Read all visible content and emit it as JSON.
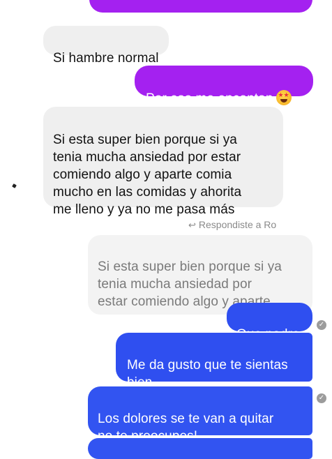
{
  "messages": [
    {
      "id": "m0",
      "direction": "outgoing",
      "color": "#a421f0",
      "text": ""
    },
    {
      "id": "m1",
      "direction": "incoming",
      "text": "Si hambre normal"
    },
    {
      "id": "m2",
      "direction": "outgoing",
      "color": "#a421f0",
      "text": "Por eso me encantan",
      "emoji": "star-struck-emoji"
    },
    {
      "id": "m3",
      "direction": "incoming",
      "text": "Si esta super bien porque si ya\ntenia mucha ansiedad por estar\ncomiendo algo y aparte comia\nmucho en las comidas y ahorita\nme lleno y ya no me pasa más"
    },
    {
      "id": "m4",
      "direction": "outgoing",
      "color": "#2f4ff0",
      "text": "Que padre"
    },
    {
      "id": "m5",
      "direction": "outgoing",
      "color": "#2f4ff0",
      "text": "Me da gusto que te sientas\nbien"
    },
    {
      "id": "m6",
      "direction": "outgoing",
      "color": "#3254f1",
      "text": "Los dolores se te van a quitar\nno te preocupes!"
    },
    {
      "id": "m7",
      "direction": "outgoing",
      "color": "#3254f1",
      "text": ""
    }
  ],
  "reply": {
    "label": "Respondiste a Ro",
    "icon": "reply-arrow-icon",
    "quoted_text": "Si esta super bien porque si ya\ntenia mucha ansiedad por\nestar comiendo algo y aparte ..."
  },
  "seen_icon": "check-circle-icon"
}
